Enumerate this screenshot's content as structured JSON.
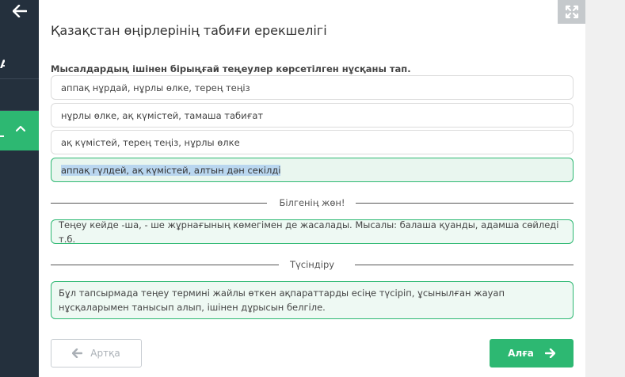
{
  "sidebar": {
    "partial_letter": "А",
    "active_item_text": "_"
  },
  "title": "Қазақстан өңірлерінің табиғи ерекшелігі",
  "question": "Мысалдардың ішінен бірыңғай теңеулер көрсетілген нұсқаны тап.",
  "options": [
    {
      "label": "аппақ нұрдай, нұрлы өлке, терең теңіз",
      "selected": false
    },
    {
      "label": "нұрлы өлке, ақ күмістей, тамаша табиғат",
      "selected": false
    },
    {
      "label": "ақ күмістей, терең теңіз, нұрлы өлке",
      "selected": false
    },
    {
      "label": "аппақ гүлдей, ақ күмістей, алтын дән секілді",
      "selected": true
    }
  ],
  "know_section": {
    "heading": "Білгенің жөн!",
    "text": "Теңеу кейде -ша, - ше жұрнағының көмегімен де жасалады. Мысалы: балаша қуанды, адамша сөйледі т.б."
  },
  "explain_section": {
    "heading": "Түсіндіру",
    "text": "Бұл тапсырмада теңеу термині жайлы өткен ақпараттарды есіңе түсіріп, ұсынылған жауап нұсқаларымен танысып алып, ішінен дұрысын белгіле."
  },
  "nav": {
    "back_label": "Артқа",
    "next_label": "Алға"
  },
  "colors": {
    "accent": "#2db872",
    "sidebar": "#24303d",
    "selection": "#b9d6ef"
  },
  "icons": {
    "sidebar_back": "arrow-left-icon",
    "sidebar_toggle": "chevron-up-icon",
    "fullscreen": "expand-icon",
    "back": "arrow-left-icon",
    "next": "arrow-right-icon"
  }
}
